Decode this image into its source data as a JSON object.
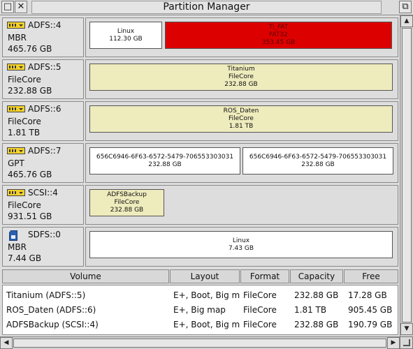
{
  "window": {
    "title": "Partition Manager",
    "back_glyph": "□",
    "close_glyph": "✕",
    "toggle_glyph": "⧉"
  },
  "drives": [
    {
      "name": "ADFS::4",
      "icon": "hard-disc-icon",
      "scheme": "MBR",
      "size": "465.76 GB",
      "partitions": [
        {
          "label": "Linux",
          "size": "112.30 GB",
          "color": "#ffffff"
        },
        {
          "label": "Ti_FAT",
          "format": "FAT32",
          "size": "353.45 GB",
          "color": "#dd0000"
        }
      ]
    },
    {
      "name": "ADFS::5",
      "icon": "hard-disc-icon",
      "scheme": "FileCore",
      "size": "232.88 GB",
      "partitions": [
        {
          "label": "Titanium",
          "format": "FileCore",
          "size": "232.88 GB",
          "color": "#eeebbd"
        }
      ]
    },
    {
      "name": "ADFS::6",
      "icon": "hard-disc-icon",
      "scheme": "FileCore",
      "size": "1.81 TB",
      "partitions": [
        {
          "label": "ROS_Daten",
          "format": "FileCore",
          "size": "1.81 TB",
          "color": "#eeebbd"
        }
      ]
    },
    {
      "name": "ADFS::7",
      "icon": "hard-disc-icon",
      "scheme": "GPT",
      "size": "465.76 GB",
      "partitions": [
        {
          "label": "656C6946-6F63-6572-5479-706553303031",
          "size": "232.88 GB",
          "color": "#ffffff"
        },
        {
          "label": "656C6946-6F63-6572-5479-706553303031",
          "size": "232.88 GB",
          "color": "#ffffff"
        }
      ]
    },
    {
      "name": "SCSI::4",
      "icon": "hard-disc-icon",
      "scheme": "FileCore",
      "size": "931.51 GB",
      "partitions": [
        {
          "label": "ADFSBackup",
          "format": "FileCore",
          "size": "232.88 GB",
          "color": "#eeebbd"
        }
      ]
    },
    {
      "name": "SDFS::0",
      "icon": "sd-card-icon",
      "scheme": "MBR",
      "size": "7.44 GB",
      "partitions": [
        {
          "label": "Linux",
          "size": "7.43 GB",
          "color": "#ffffff"
        }
      ]
    }
  ],
  "volume_table": {
    "columns": [
      "Volume",
      "Layout",
      "Format",
      "Capacity",
      "Free"
    ],
    "rows": [
      [
        "Titanium (ADFS::5)",
        "E+, Boot, Big map",
        "FileCore",
        "232.88 GB",
        "17.28 GB"
      ],
      [
        "ROS_Daten (ADFS::6)",
        "E+, Big map",
        "FileCore",
        "1.81 TB",
        "905.45 GB"
      ],
      [
        "ADFSBackup (SCSI::4)",
        "E+, Boot, Big map",
        "FileCore",
        "232.88 GB",
        "190.79 GB"
      ]
    ]
  },
  "scrollbars": {
    "up_glyph": "▲",
    "down_glyph": "▼",
    "left_glyph": "◀",
    "right_glyph": "▶"
  }
}
